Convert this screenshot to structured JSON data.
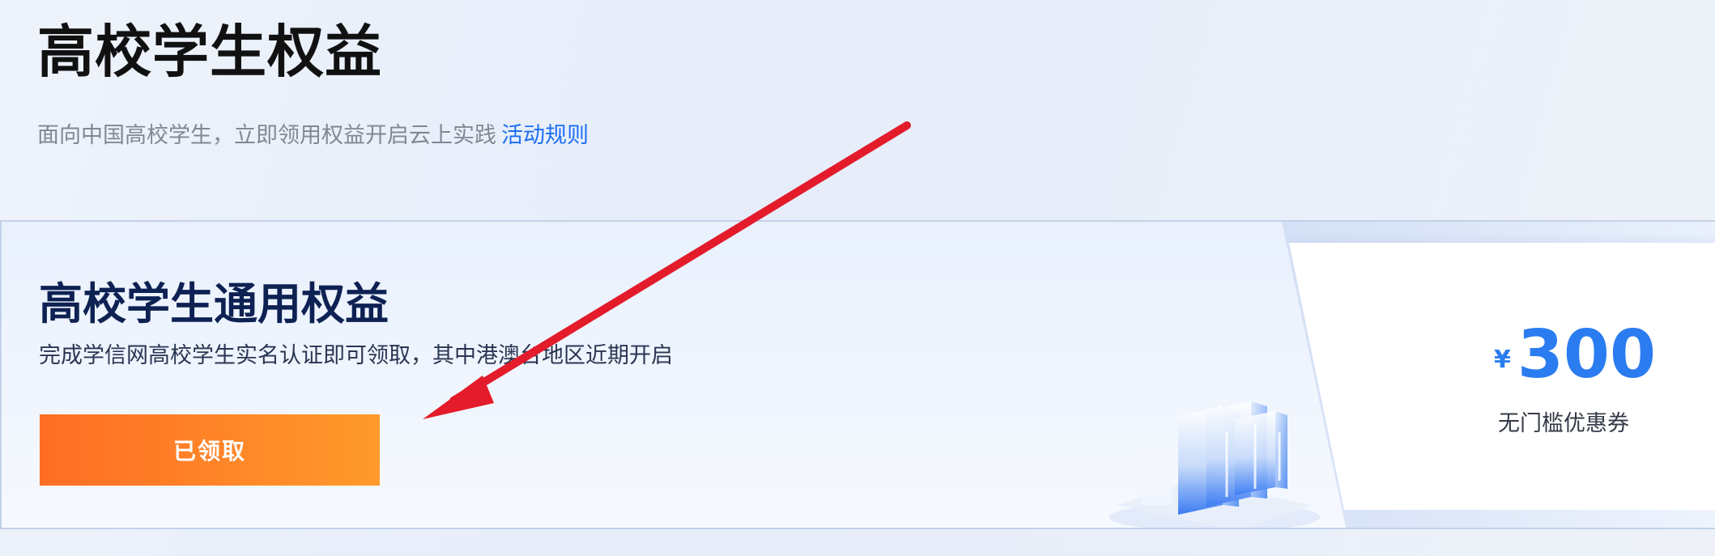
{
  "header": {
    "title": "高校学生权益",
    "subtitle": "面向中国高校学生，立即领用权益开启云上实践",
    "rules_link": "活动规则"
  },
  "benefit_card": {
    "title": "高校学生通用权益",
    "description": "完成学信网高校学生实名认证即可领取，其中港澳台地区近期开启",
    "button_label": "已领取"
  },
  "coupon": {
    "currency": "¥",
    "amount": "300",
    "label": "无门槛优惠券"
  },
  "colors": {
    "accent_blue": "#1c6ff5",
    "price_blue": "#2b7cf0",
    "button_orange_start": "#ff6d24",
    "button_orange_end": "#ff9a2b",
    "annotation_arrow": "#e31b2a",
    "title_navy": "#0e2153"
  },
  "icons": {
    "illustration": "server-racks-illustration",
    "annotation": "red-arrow-annotation"
  }
}
